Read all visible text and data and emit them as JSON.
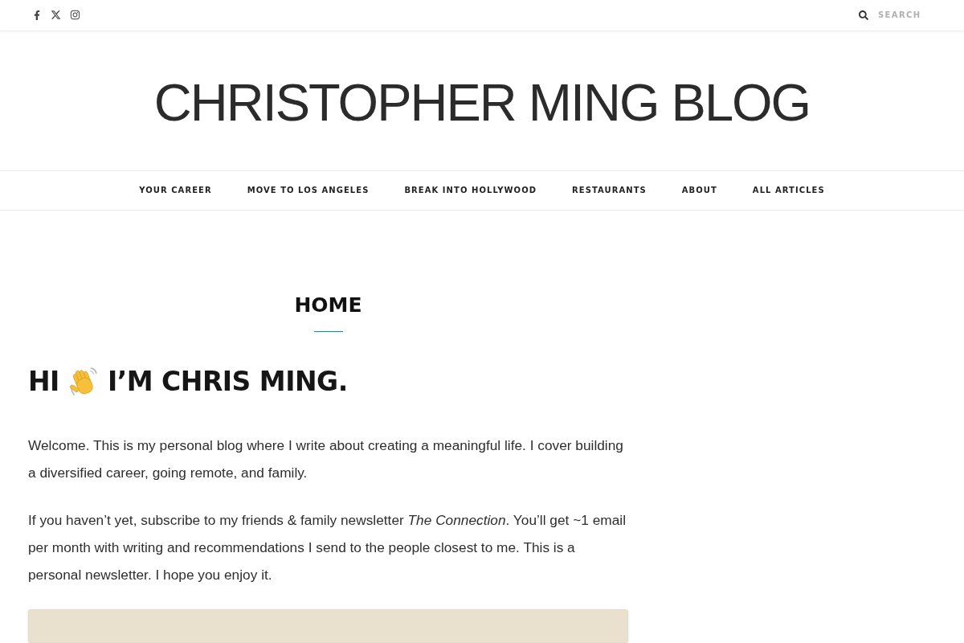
{
  "top_bar": {
    "search": {
      "placeholder": "SEARCH"
    }
  },
  "site_title": "CHRISTOPHER MING BLOG",
  "nav": {
    "items": [
      "YOUR CAREER",
      "MOVE TO LOS ANGELES",
      "BREAK INTO HOLLYWOOD",
      "RESTAURANTS",
      "ABOUT",
      "ALL ARTICLES"
    ]
  },
  "page_title": "HOME",
  "greeting": {
    "before": "HI",
    "after": "I’M CHRIS MING."
  },
  "paragraphs": [
    "Welcome. This is my personal blog where I write about creating a meaningful life. I cover building a diversified career, going remote, and family.",
    "If you haven’t yet, subscribe to my friends & family newsletter *The Connection*. You’ll get ~1 email per month with writing and recommendations I send to the people closest to me. This is a personal newsletter. I hope you enjoy it."
  ]
}
